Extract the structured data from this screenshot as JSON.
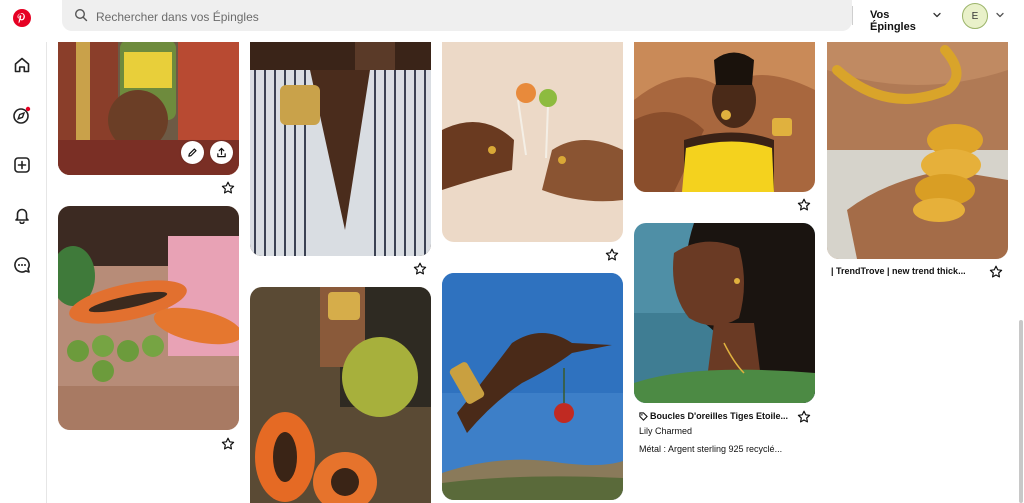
{
  "search": {
    "placeholder": "Rechercher dans vos Épingles"
  },
  "header": {
    "board_selector_label": "Vos Épingles",
    "avatar_initial": "E"
  },
  "nav_icons": [
    "pinterest-logo",
    "home-icon",
    "explore-icon",
    "create-icon",
    "notifications-icon",
    "messages-icon"
  ],
  "pins": {
    "earrings": {
      "title": "Boucles D'oreilles Tiges Etoile...",
      "author": "Lily Charmed",
      "description": "Métal : Argent sterling 925 recyclé..."
    },
    "bracelets": {
      "title": "| TrendTrove | new trend thick..."
    }
  },
  "colors": {
    "brand_red": "#e60023"
  }
}
